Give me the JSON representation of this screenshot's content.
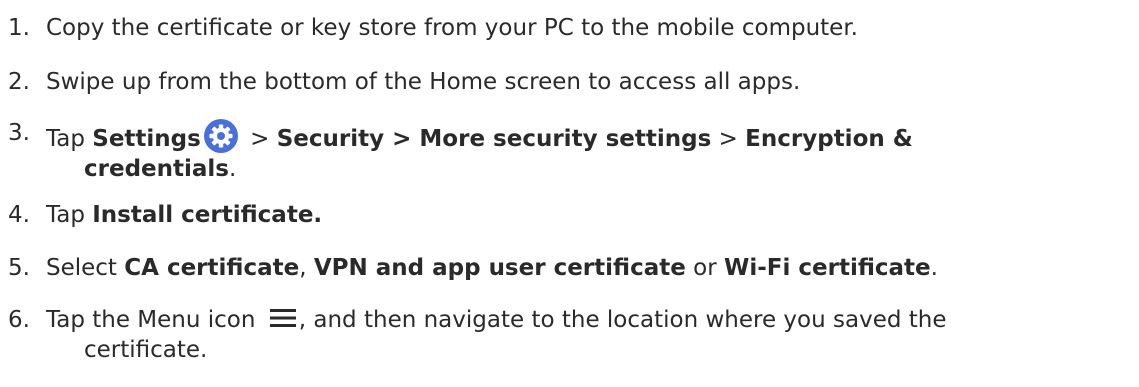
{
  "steps": [
    {
      "number": "1.",
      "text": "Copy the certificate or key store from your PC to the mobile computer."
    },
    {
      "number": "2.",
      "text": "Swipe up from the bottom of the Home screen to access all apps."
    },
    {
      "number": "3.",
      "tap": "Tap ",
      "settings": "Settings",
      "gt1": " > ",
      "security_path": "Security > More security settings",
      "gt2": " > ",
      "encryption": "Encryption &",
      "credentials": "credentials",
      "period": "."
    },
    {
      "number": "4.",
      "tap": "Tap ",
      "install": "Install certificate."
    },
    {
      "number": "5.",
      "select": "Select ",
      "ca": "CA certificate",
      "comma": ", ",
      "vpn": "VPN and app user certificate",
      "or": " or ",
      "wifi": "Wi-Fi certificate",
      "period": "."
    },
    {
      "number": "6.",
      "text_before_icon": "Tap the Menu icon ",
      "text_after_icon": ", and then navigate to the location where you saved the",
      "line2": "certificate."
    }
  ],
  "icons": {
    "settings_icon": "gear-icon",
    "menu_icon": "menu-icon",
    "settings_icon_color": "#4a6fd8"
  }
}
